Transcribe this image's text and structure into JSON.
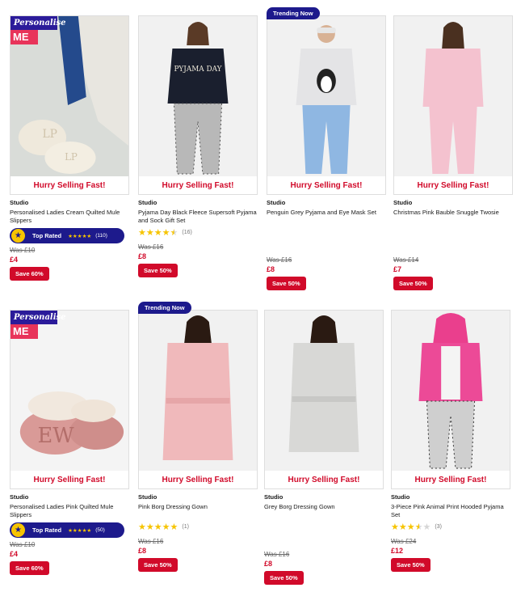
{
  "colors": {
    "accent_red": "#d10a2a",
    "navy": "#1d1a8c",
    "personalise_pink": "#e8345a",
    "star": "#f6c400"
  },
  "labels": {
    "hurry": "Hurry Selling Fast!",
    "trending": "Trending Now",
    "personalise_line1": "Personalise",
    "personalise_line2": "ME",
    "top_rated": "Top Rated"
  },
  "products": [
    {
      "brand": "Studio",
      "title": "Personalised Ladies Cream Quilted Mule Slippers",
      "top_rated_count": "(110)",
      "top_rated_stars": 5,
      "was": "Was £10",
      "price": "£4",
      "save": "Save 60%",
      "personalise": true,
      "trending": false,
      "photo": "cream-slippers"
    },
    {
      "brand": "Studio",
      "title": "Pyjama Day Black Fleece Supersoft Pyjama and Sock Gift Set",
      "rating": 4.5,
      "rating_count": "(16)",
      "was": "Was £16",
      "price": "£8",
      "save": "Save 50%",
      "personalise": false,
      "trending": false,
      "photo": "black-pyjama",
      "photo_text": "PYJAMA DAY"
    },
    {
      "brand": "Studio",
      "title": "Penguin Grey Pyjama and Eye Mask Set",
      "was": "Was £16",
      "price": "£8",
      "save": "Save 50%",
      "personalise": false,
      "trending": true,
      "photo": "penguin-pyjama"
    },
    {
      "brand": "Studio",
      "title": "Christmas Pink Bauble Snuggle Twosie",
      "was": "Was £14",
      "price": "£7",
      "save": "Save 50%",
      "personalise": false,
      "trending": false,
      "photo": "pink-twosie"
    },
    {
      "brand": "Studio",
      "title": "Personalised Ladies Pink Quilted Mule Slippers",
      "top_rated_count": "(50)",
      "top_rated_stars": 5,
      "was": "Was £10",
      "price": "£4",
      "save": "Save 60%",
      "personalise": true,
      "trending": false,
      "photo": "pink-slippers",
      "photo_text": "EW"
    },
    {
      "brand": "Studio",
      "title": "Pink Borg Dressing Gown",
      "rating": 5,
      "rating_count": "(1)",
      "was": "Was £16",
      "price": "£8",
      "save": "Save 50%",
      "personalise": false,
      "trending": true,
      "photo": "pink-gown"
    },
    {
      "brand": "Studio",
      "title": "Grey Borg Dressing Gown",
      "was": "Was £16",
      "price": "£8",
      "save": "Save 50%",
      "personalise": false,
      "trending": false,
      "photo": "grey-gown"
    },
    {
      "brand": "Studio",
      "title": "3-Piece Pink Animal Print Hooded Pyjama Set",
      "rating": 3.5,
      "rating_count": "(3)",
      "was": "Was £24",
      "price": "£12",
      "save": "Save 50%",
      "personalise": false,
      "trending": false,
      "photo": "pink-hooded-set"
    }
  ]
}
